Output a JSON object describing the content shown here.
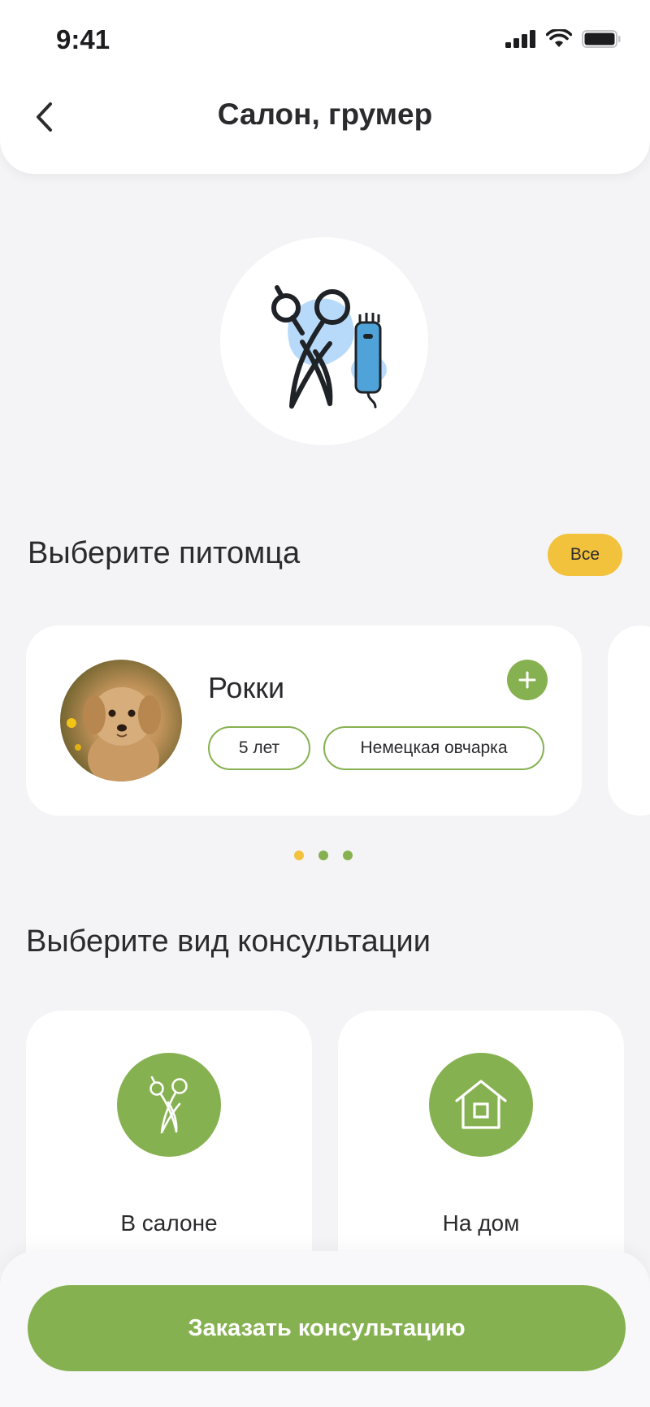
{
  "status_bar": {
    "time": "9:41"
  },
  "header": {
    "title": "Салон, грумер"
  },
  "hero": {
    "icon": "scissors-clipper-icon"
  },
  "pet_section": {
    "title": "Выберите питомца",
    "all_label": "Все",
    "pet": {
      "name": "Рокки",
      "age": "5 лет",
      "breed": "Немецкая овчарка"
    },
    "pagination": {
      "count": 3,
      "active_index": 0
    }
  },
  "consult_section": {
    "title": "Выберите вид консультации",
    "options": [
      {
        "label": "В салоне",
        "icon": "scissors-icon"
      },
      {
        "label": "На дом",
        "icon": "house-icon"
      }
    ]
  },
  "cta": {
    "label": "Заказать консультацию"
  },
  "colors": {
    "accent_green": "#86b150",
    "accent_yellow": "#f2c23d",
    "background": "#f4f4f6",
    "hero_blue": "#4fa3d9"
  }
}
